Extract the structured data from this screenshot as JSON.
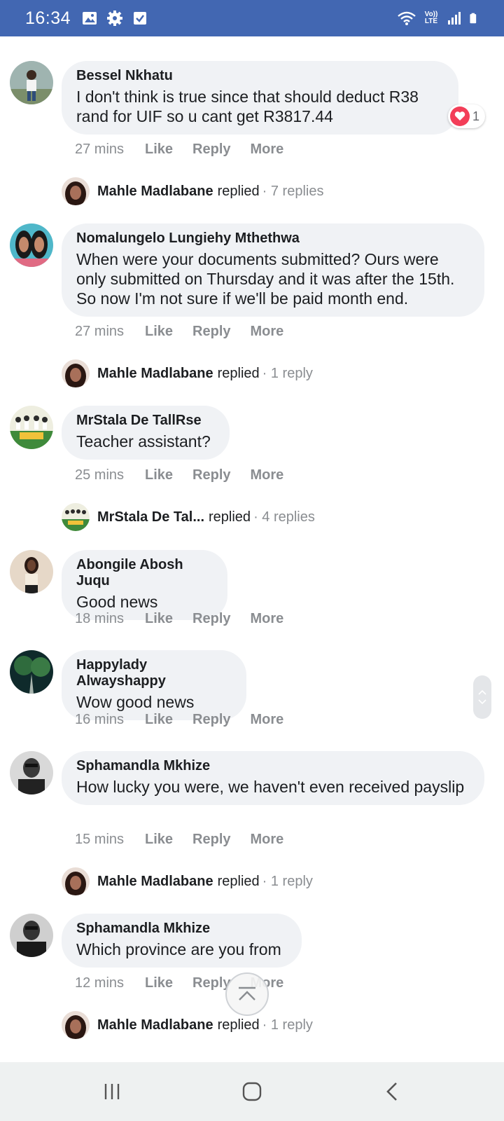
{
  "status_bar": {
    "time": "16:34",
    "lte_label": "Vo)) LTE",
    "icons": [
      "image-icon",
      "gear-icon",
      "checkbox-icon",
      "wifi-icon",
      "volte-icon",
      "signal-icon",
      "battery-icon"
    ],
    "background": "#4267b2"
  },
  "action_labels": {
    "like": "Like",
    "reply": "Reply",
    "more": "More"
  },
  "comments": [
    {
      "name": "Bessel Nkhatu",
      "text": "I don't think is true since that should deduct R38 rand for UIF so u cant get R3817.44",
      "time": "27 mins",
      "reaction": {
        "icon": "heart-icon",
        "count": "1"
      }
    },
    {
      "name": "Nomalungelo Lungiehy Mthethwa",
      "text": "When were your documents submitted? Ours were only submitted on Thursday and it was after the 15th. So now I'm not sure if we'll be paid month end.",
      "time": "27 mins"
    },
    {
      "name": "MrStala De TallRse",
      "text": "Teacher assistant?",
      "time": "25 mins"
    },
    {
      "name": "Abongile Abosh Juqu",
      "text": "Good news",
      "time": "18 mins"
    },
    {
      "name": "Happylady Alwayshappy",
      "text": "Wow good news",
      "time": "16 mins"
    },
    {
      "name": "Sphamandla Mkhize",
      "text": "How lucky you were, we haven't even received payslip",
      "time": "15 mins"
    },
    {
      "name": "Sphamandla Mkhize",
      "text": "Which province are you from",
      "time": "12 mins"
    }
  ],
  "replies": [
    {
      "name": "Mahle Madlabane",
      "word": "replied",
      "count": "· 7 replies"
    },
    {
      "name": "Mahle Madlabane",
      "word": "replied",
      "count": "· 1 reply"
    },
    {
      "name": "MrStala De Tal...",
      "word": "replied",
      "count": "· 4 replies"
    },
    {
      "name": "Mahle Madlabane",
      "word": "replied",
      "count": "· 1 reply"
    },
    {
      "name": "Mahle Madlabane",
      "word": "replied",
      "count": "· 1 reply"
    }
  ],
  "colors": {
    "bubble": "#f0f2f5",
    "meta": "#8a8d91",
    "heart": "#f33e58",
    "navbar": "#eef1f1"
  }
}
